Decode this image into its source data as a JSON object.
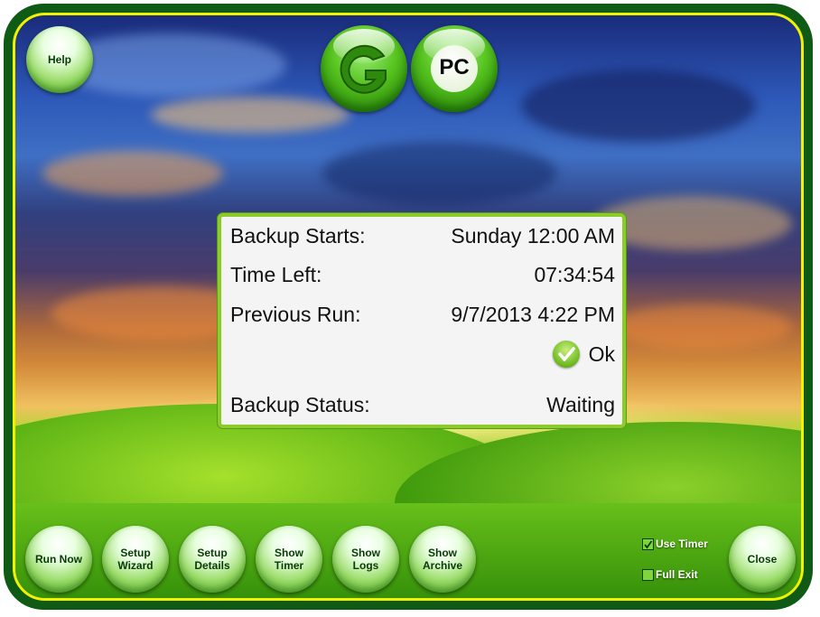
{
  "help_label": "Help",
  "logo": {
    "text": "PC",
    "letter_glyph": "G-logo"
  },
  "status": {
    "backup_starts_label": "Backup Starts:",
    "backup_starts_value": "Sunday 12:00 AM",
    "time_left_label": "Time Left:",
    "time_left_value": "07:34:54",
    "previous_run_label": "Previous Run:",
    "previous_run_value": "9/7/2013 4:22 PM",
    "result_text": "Ok",
    "result_icon": "checkmark-icon",
    "backup_status_label": "Backup Status:",
    "backup_status_value": "Waiting"
  },
  "buttons": {
    "run_now": [
      "Run Now"
    ],
    "setup_wizard": [
      "Setup",
      "Wizard"
    ],
    "setup_details": [
      "Setup",
      "Details"
    ],
    "show_timer": [
      "Show",
      "Timer"
    ],
    "show_logs": [
      "Show",
      "Logs"
    ],
    "show_archive": [
      "Show",
      "Archive"
    ],
    "close": [
      "Close"
    ]
  },
  "options": {
    "use_timer": {
      "label": "Use Timer",
      "checked": true
    },
    "full_exit": {
      "label": "Full Exit",
      "checked": false
    }
  },
  "colors": {
    "frame": "#0f5a14",
    "border": "#f2f200",
    "accent": "#8ccc2a"
  }
}
